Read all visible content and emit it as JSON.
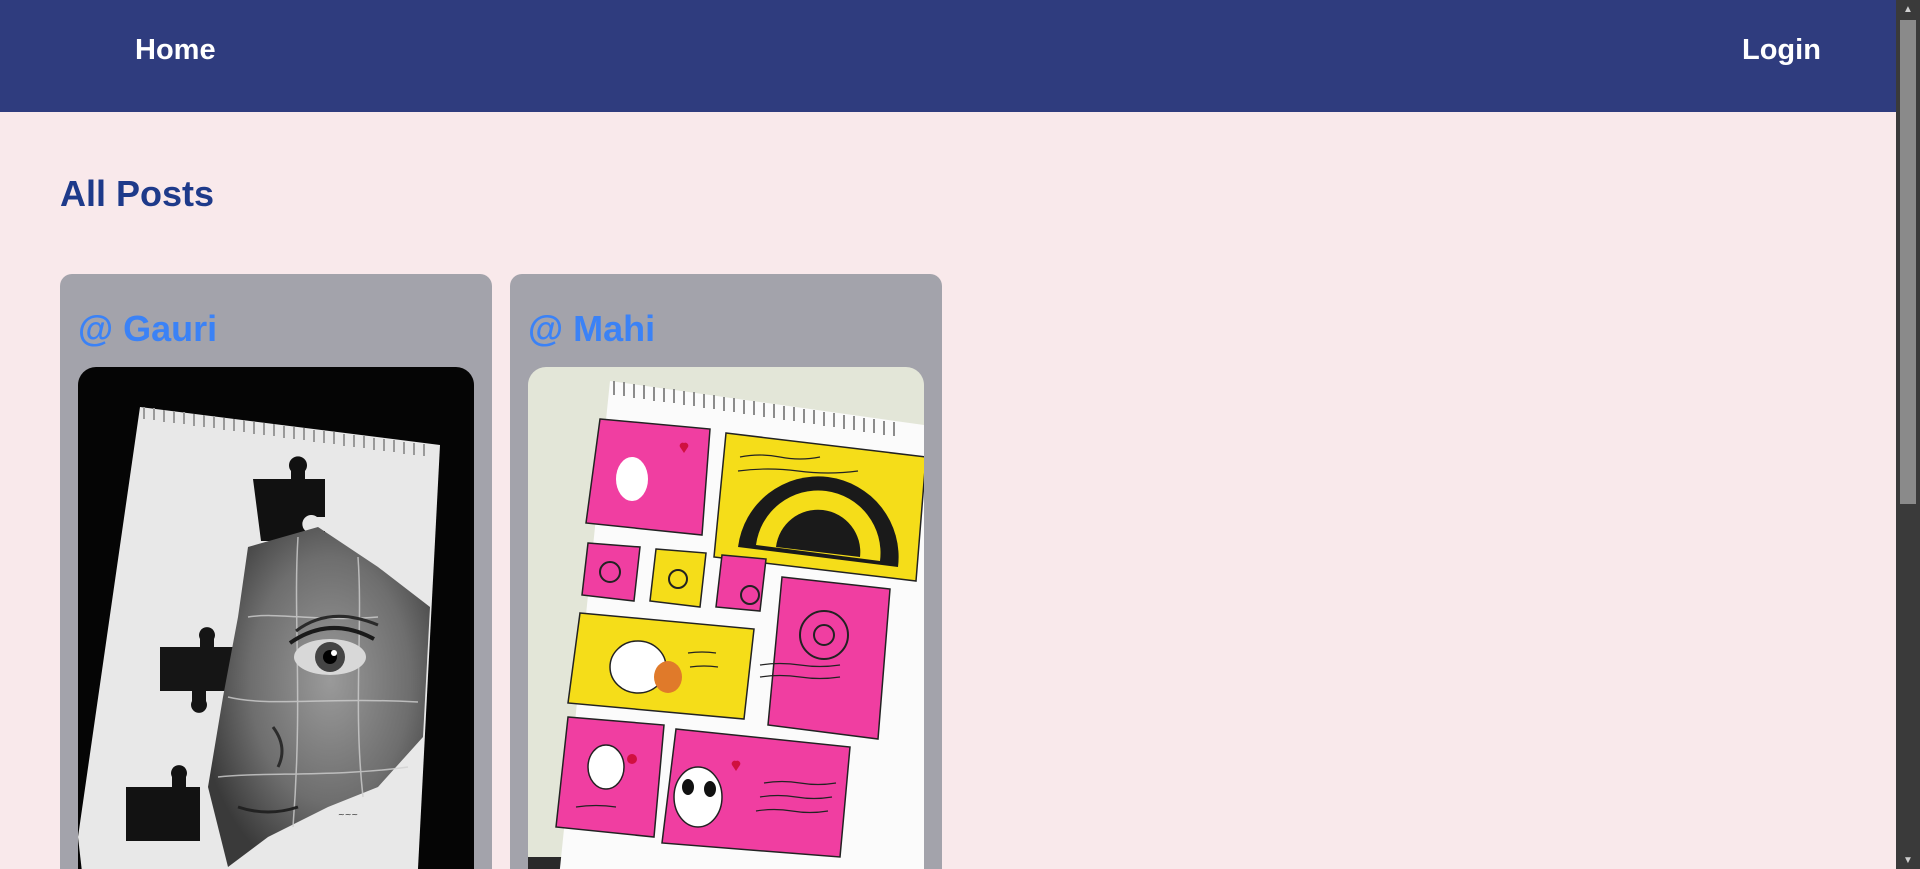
{
  "nav": {
    "home_label": "Home",
    "login_label": "Login"
  },
  "page": {
    "title": "All Posts"
  },
  "posts": [
    {
      "author": "@ Gauri",
      "image_subject": "puzzle-eye-sketch"
    },
    {
      "author": "@ Mahi",
      "image_subject": "self-love-journal-page"
    }
  ],
  "colors": {
    "navbar": "#2f3c7e",
    "background": "#f9e9eb",
    "card": "#a3a3ab",
    "author_link": "#3b82f6",
    "title": "#1e3a8a"
  },
  "scrollbar": {
    "up_icon": "▲",
    "down_icon": "▼"
  }
}
